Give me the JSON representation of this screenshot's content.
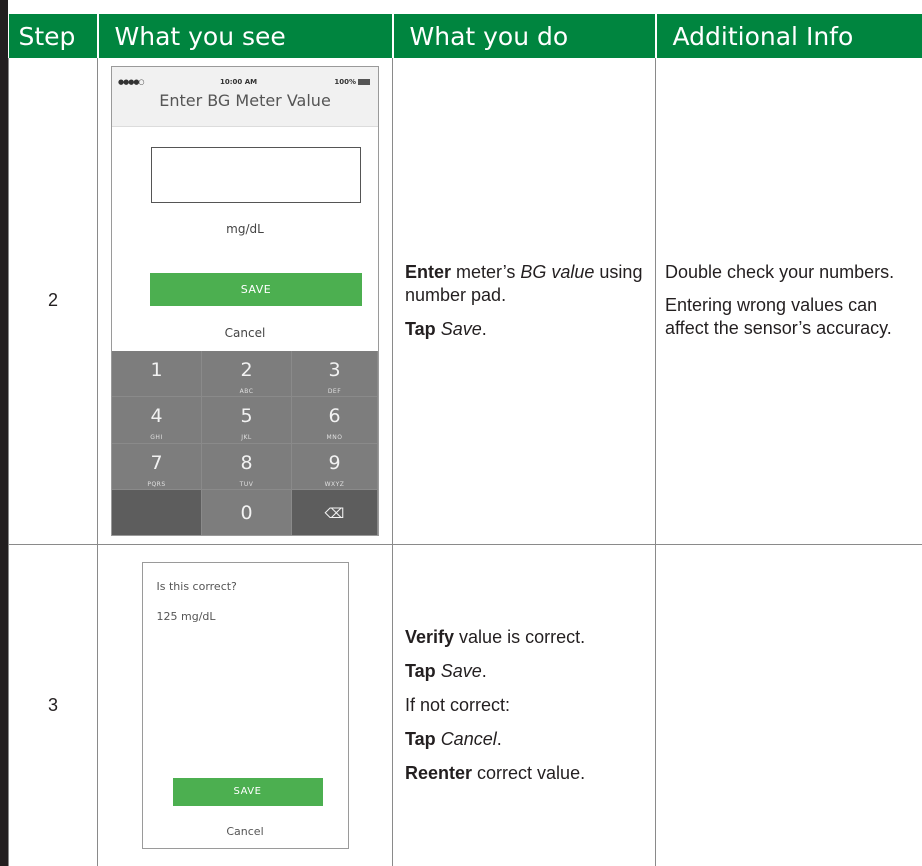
{
  "colors": {
    "header_bg": "#00853f",
    "save_button": "#4caf50"
  },
  "headers": {
    "step": "Step",
    "see": "What you see",
    "do": "What you do",
    "info": "Additional Info"
  },
  "rows": [
    {
      "step": "2",
      "screen": {
        "signal": "●●●●○",
        "time": "10:00 AM",
        "battery": "100%",
        "title": "Enter BG Meter Value",
        "unit": "mg/dL",
        "save": "SAVE",
        "cancel": "Cancel",
        "keys": [
          {
            "n": "1",
            "l": ""
          },
          {
            "n": "2",
            "l": "ABC"
          },
          {
            "n": "3",
            "l": "DEF"
          },
          {
            "n": "4",
            "l": "GHI"
          },
          {
            "n": "5",
            "l": "JKL"
          },
          {
            "n": "6",
            "l": "MNO"
          },
          {
            "n": "7",
            "l": "PQRS"
          },
          {
            "n": "8",
            "l": "TUV"
          },
          {
            "n": "9",
            "l": "WXYZ"
          },
          {
            "n": "0"
          },
          {
            "n": "⌫"
          }
        ]
      },
      "do": [
        {
          "bold": "Enter",
          "text1": " meter’s ",
          "em": "BG value",
          "text2": " using number pad."
        },
        {
          "bold": "Tap",
          "text1": " ",
          "em": "Save",
          "text2": "."
        }
      ],
      "info": [
        "Double check your numbers.",
        "Entering wrong values can affect the sensor’s accuracy."
      ]
    },
    {
      "step": "3",
      "screen": {
        "question": "Is this correct?",
        "value": "125 mg/dL",
        "save": "SAVE",
        "cancel": "Cancel"
      },
      "do": [
        {
          "bold": "Verify",
          "text1": " value is correct.",
          "em": "",
          "text2": ""
        },
        {
          "bold": "Tap",
          "text1": " ",
          "em": "Save",
          "text2": "."
        },
        {
          "bold": "",
          "text1": "If not correct:",
          "em": "",
          "text2": ""
        },
        {
          "bold": "Tap",
          "text1": " ",
          "em": "Cancel",
          "text2": "."
        },
        {
          "bold": "Reenter",
          "text1": " correct value.",
          "em": "",
          "text2": ""
        }
      ],
      "info": []
    }
  ]
}
